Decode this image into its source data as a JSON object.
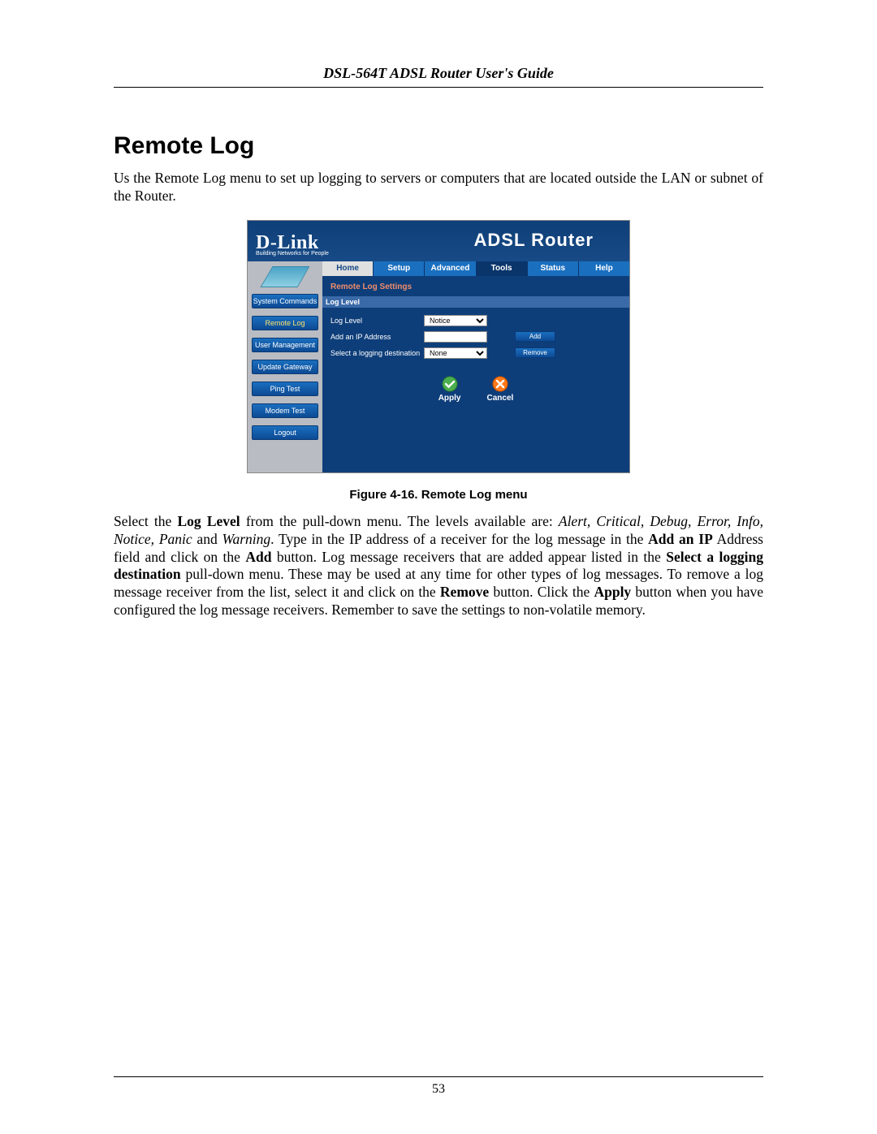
{
  "doc": {
    "header": "DSL-564T ADSL Router User's Guide",
    "section_title": "Remote Log",
    "intro": "Us the Remote Log menu to set up logging to servers or computers that are located outside the LAN or subnet of the Router.",
    "figure_caption": "Figure 4-16. Remote Log menu",
    "para2_a": "Select the ",
    "para2_b_bold": "Log Level",
    "para2_c": " from the pull-down menu. The levels available are: ",
    "para2_levels_italic": "Alert, Critical, Debug, Error, Info, Notice, Panic",
    "para2_d": " and ",
    "para2_warning_italic": "Warning",
    "para2_e": ".  Type in the IP address of a receiver for the log message in the ",
    "para2_f_bold": "Add an IP",
    "para2_g": " Address field and click on the ",
    "para2_h_bold": "Add",
    "para2_i": " button. Log message receivers that are added appear listed in the ",
    "para2_j_bold": "Select a logging destination",
    "para2_k": " pull-down menu. These may be used at any time for other types of log messages. To remove a log message receiver from the list, select it and click on the ",
    "para2_l_bold": "Remove",
    "para2_m": " button. Click the ",
    "para2_n_bold": "Apply",
    "para2_o": " button when you have configured the log message receivers. Remember to save the settings to non-volatile memory.",
    "page_number": "53"
  },
  "router": {
    "brand": "D-Link",
    "brand_tagline": "Building Networks for People",
    "banner_title": "ADSL Router",
    "tabs": {
      "home": "Home",
      "setup": "Setup",
      "advanced": "Advanced",
      "tools": "Tools",
      "status": "Status",
      "help": "Help"
    },
    "sidebar": {
      "system_commands": "System Commands",
      "remote_log": "Remote Log",
      "user_management": "User Management",
      "update_gateway": "Update Gateway",
      "ping_test": "Ping Test",
      "modem_test": "Modem Test",
      "logout": "Logout"
    },
    "panel": {
      "heading": "Remote Log Settings",
      "sub_bar": "Log Level",
      "row1_label": "Log Level",
      "row1_value": "Notice",
      "row2_label": "Add an IP Address",
      "row2_button": "Add",
      "row3_label": "Select a logging destination",
      "row3_value": "None",
      "row3_button": "Remove",
      "apply": "Apply",
      "cancel": "Cancel"
    }
  }
}
